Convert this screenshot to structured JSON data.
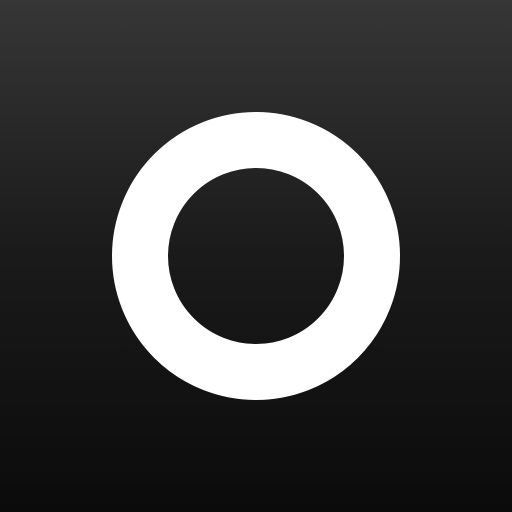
{
  "icon": {
    "name": "ring-logo-icon",
    "colors": {
      "background_top": "#363636",
      "background_middle": "#1a1a1a",
      "background_bottom": "#0b0b0b",
      "ring": "#ffffff"
    }
  }
}
